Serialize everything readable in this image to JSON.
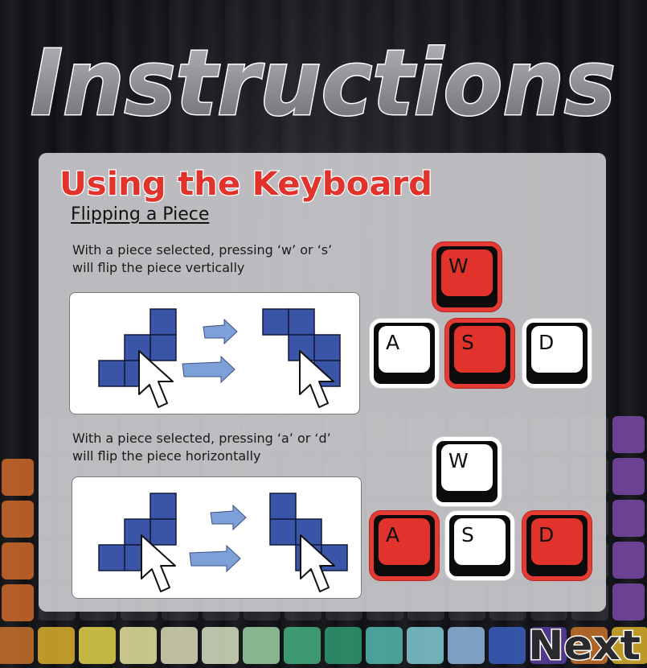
{
  "title": "Instructions",
  "section": {
    "title": "Using the Keyboard",
    "subtitle": "Flipping a Piece"
  },
  "vertical_flip": {
    "line1": "With a piece selected, pressing ‘w’ or ‘s’",
    "line2": "will flip the piece vertically",
    "keys": [
      {
        "label": "W",
        "active": true
      },
      {
        "label": "A",
        "active": false
      },
      {
        "label": "S",
        "active": true
      },
      {
        "label": "D",
        "active": false
      }
    ]
  },
  "horizontal_flip": {
    "line1": "With a piece selected, pressing ‘a’ or ‘d’",
    "line2": "will flip the piece horizontally",
    "keys": [
      {
        "label": "W",
        "active": false
      },
      {
        "label": "A",
        "active": true
      },
      {
        "label": "S",
        "active": false
      },
      {
        "label": "D",
        "active": true
      }
    ]
  },
  "next_label": "Next",
  "colors": {
    "accent_red": "#e1322c",
    "piece_blue": "#3a55a8",
    "arrow_blue": "#7da0d8",
    "panel_gray": "#cdcdd0"
  },
  "icons": [
    "mouse-cursor-icon",
    "right-arrow-icon",
    "key-icon"
  ]
}
